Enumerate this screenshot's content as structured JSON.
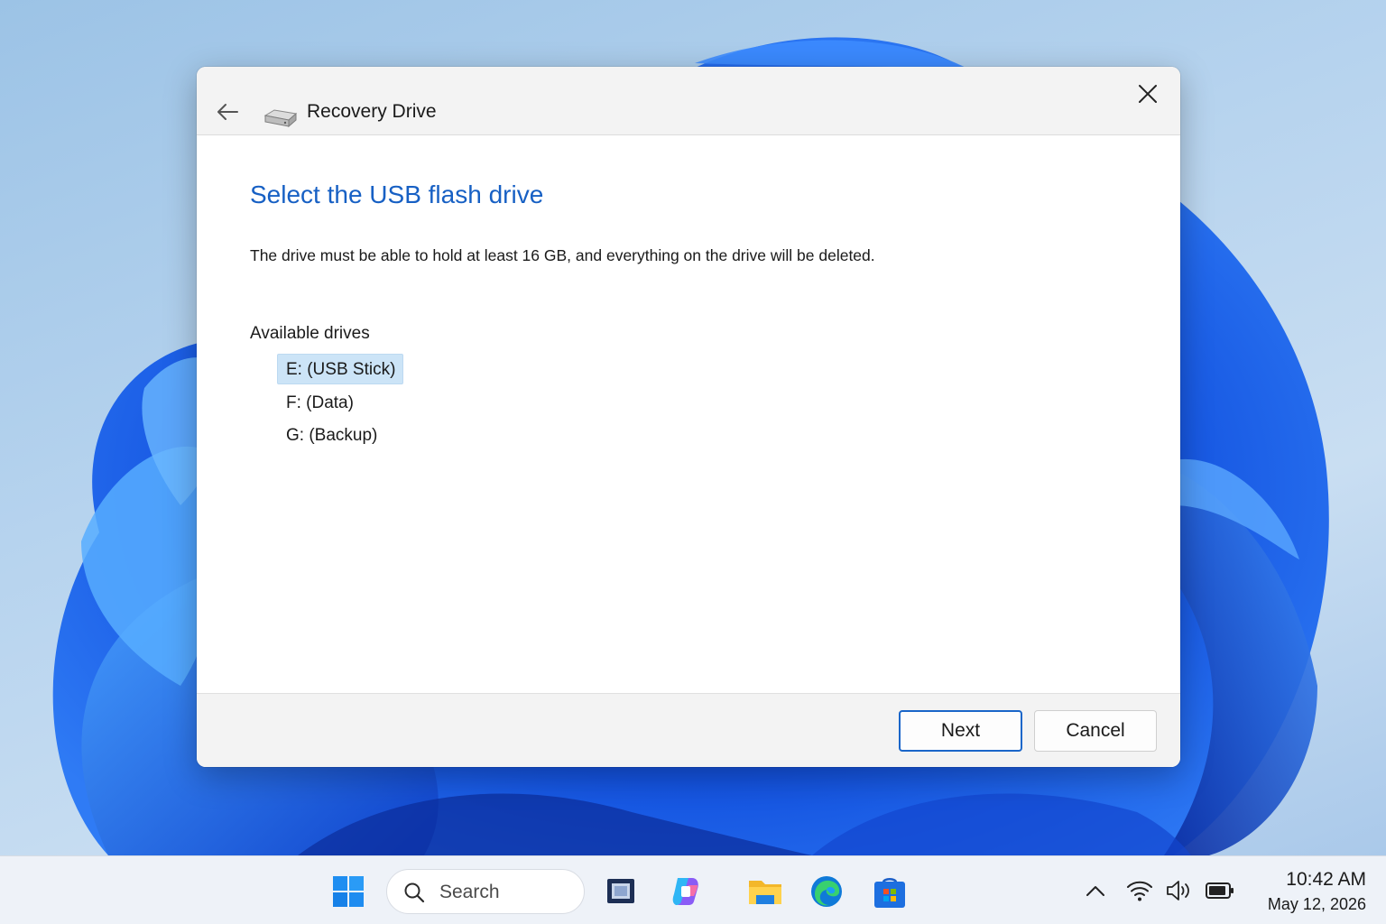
{
  "window": {
    "title": "Recovery Drive",
    "app_icon": "drive-icon",
    "back_icon": "arrow-left-icon",
    "close_icon": "close-icon"
  },
  "content": {
    "heading": "Select the USB flash drive",
    "description": "The drive must be able to hold at least 16 GB, and everything on the drive will be deleted.",
    "drives_label": "Available drives",
    "drives": [
      {
        "label": "E: (USB Stick)",
        "selected": true
      },
      {
        "label": "F: (Data)",
        "selected": false
      },
      {
        "label": "G: (Backup)",
        "selected": false
      }
    ]
  },
  "footer": {
    "next_label": "Next",
    "cancel_label": "Cancel"
  },
  "taskbar": {
    "search_placeholder": "Search",
    "apps": [
      "windows-start-icon",
      "task-view-icon",
      "copilot-icon",
      "file-explorer-icon",
      "edge-icon",
      "store-icon"
    ],
    "tray": [
      "chevron-up-icon",
      "wifi-icon",
      "volume-icon",
      "battery-icon"
    ],
    "time": "10:42 AM",
    "date": "May 12, 2026"
  },
  "colors": {
    "accent": "#1760c4",
    "selection": "#cce4f7",
    "button_border": "#1a66c9"
  }
}
